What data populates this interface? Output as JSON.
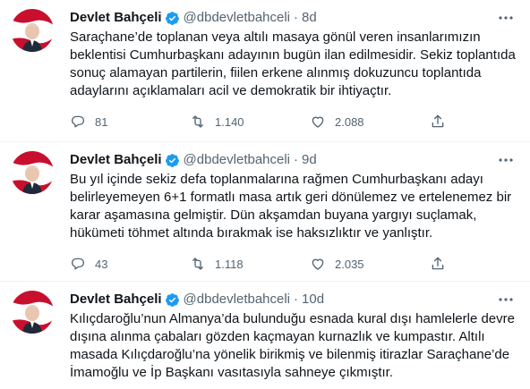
{
  "tweets": [
    {
      "name": "Devlet Bahçeli",
      "handle": "@dbdevletbahceli",
      "separator": "·",
      "time": "8d",
      "text": "Saraçhane’de toplanan veya altılı masaya gönül veren insanlarımızın\nbeklentisi Cumhurbaşkanı adayının bugün ilan edilmesidir. Sekiz toplantıda\nsonuç alamayan partilerin, fiilen erkene alınmış dokuzuncu toplantıda\nadaylarını açıklamaları acil ve demokratik bir ihtiyaçtır.",
      "replies": "81",
      "retweets": "1.140",
      "likes": "2.088"
    },
    {
      "name": "Devlet Bahçeli",
      "handle": "@dbdevletbahceli",
      "separator": "·",
      "time": "9d",
      "text": "Bu yıl içinde sekiz defa toplanmalarına rağmen Cumhurbaşkanı adayı\nbelirleyemeyen 6+1 formatlı masa artık geri dönülemez ve ertelenemez bir\nkarar aşamasına gelmiştir. Dün akşamdan buyana yargıyı suçlamak,\nhükümeti töhmet altında bırakmak ise haksızlıktır ve yanlıştır.",
      "replies": "43",
      "retweets": "1.118",
      "likes": "2.035"
    },
    {
      "name": "Devlet Bahçeli",
      "handle": "@dbdevletbahceli",
      "separator": "·",
      "time": "10d",
      "text": "Kılıçdaroğlu’nun Almanya’da bulunduğu esnada kural dışı hamlelerle devre\ndışına alınma çabaları gözden kaçmayan kurnazlık ve kumpastır. Altılı\nmasada Kılıçdaroğlu’na yönelik birikmiş ve bilenmiş itirazlar Saraçhane’de\nİmamoğlu ve İp Başkanı vasıtasıyla sahneye çıkmıştır."
    }
  ],
  "colors": {
    "verified": "#1d9bf0",
    "muted": "#536471",
    "text": "#0f1419",
    "avatar_red": "#c8102e"
  },
  "icons": {
    "reply": "reply-icon",
    "retweet": "retweet-icon",
    "like": "heart-icon",
    "share": "share-icon",
    "more": "more-icon",
    "verified": "verified-badge-icon"
  }
}
